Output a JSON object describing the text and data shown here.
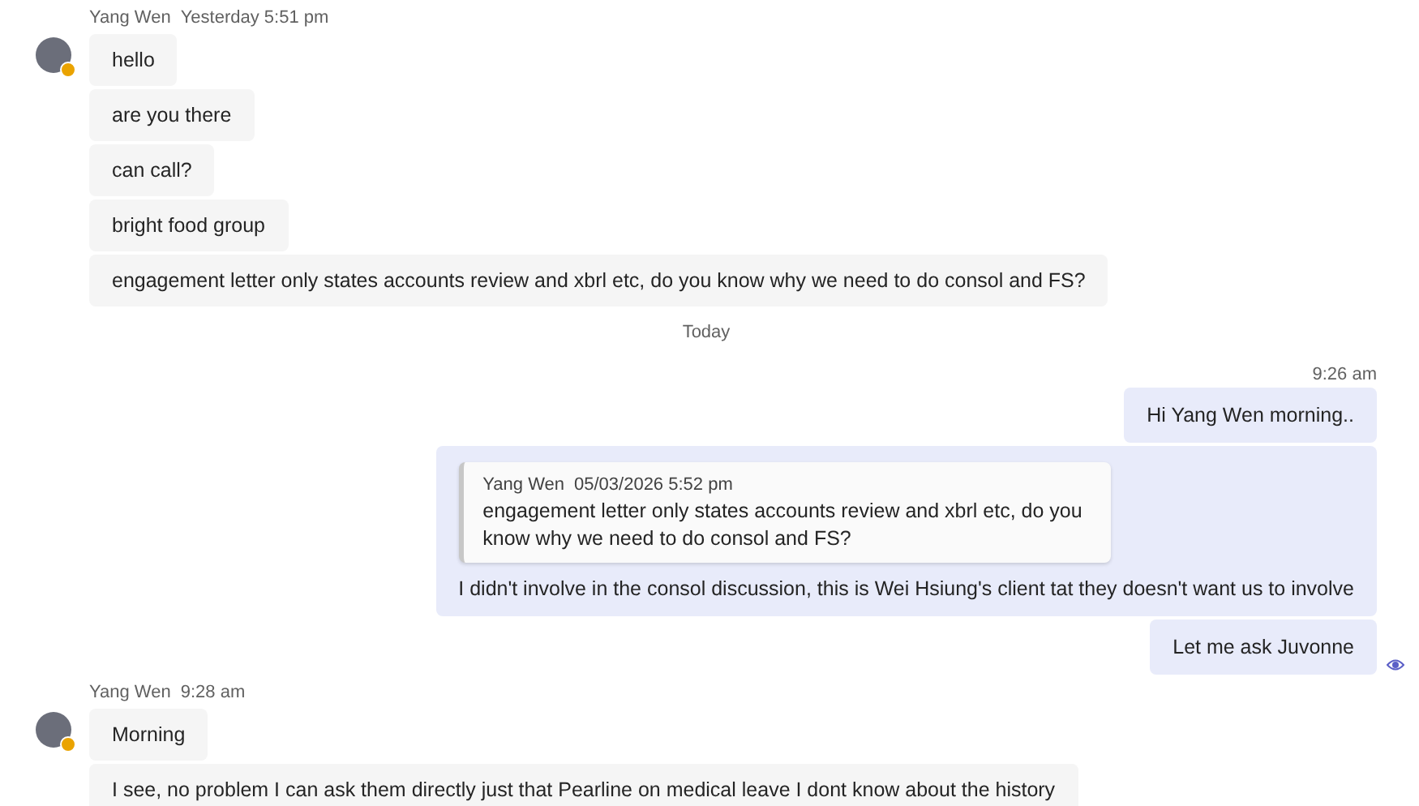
{
  "conversation": [
    {
      "kind": "incoming",
      "sender": "Yang Wen",
      "time": "Yesterday 5:51 pm",
      "away": true,
      "messages": [
        {
          "text": "hello"
        },
        {
          "text": "are you there"
        },
        {
          "text": "can call?"
        },
        {
          "text": "bright food group"
        },
        {
          "text": "engagement letter only states accounts review and xbrl etc, do you know why we need to do consol and FS?"
        }
      ]
    },
    {
      "kind": "divider",
      "label": "Today"
    },
    {
      "kind": "outgoing",
      "time": "9:26 am",
      "messages": [
        {
          "text": "Hi Yang Wen morning..",
          "seen": false
        },
        {
          "text": "I didn't involve in the consol discussion, this is Wei Hsiung's client tat they doesn't want us to involve",
          "seen": false,
          "quote": {
            "sender": "Yang Wen",
            "time": "05/03/2026 5:52 pm",
            "text": "engagement letter only states accounts review and xbrl etc, do you know why we need to do consol and FS?"
          }
        },
        {
          "text": "Let me ask Juvonne",
          "seen": true
        }
      ]
    },
    {
      "kind": "incoming",
      "sender": "Yang Wen",
      "time": "9:28 am",
      "away": true,
      "messages": [
        {
          "text": "Morning"
        },
        {
          "text": "I see, no problem I can ask them directly just that Pearline on medical leave I dont know about the history"
        }
      ]
    }
  ]
}
